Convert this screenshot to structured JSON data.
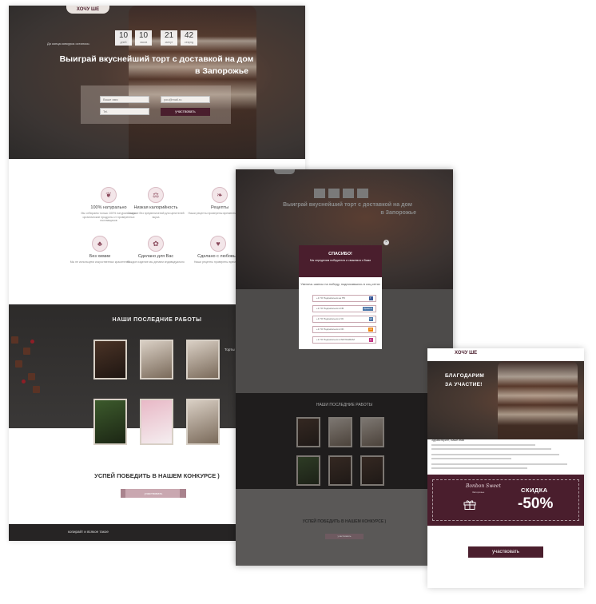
{
  "colors": {
    "brand_maroon": "#4a1e2d",
    "accent_pink": "#c9a7b0",
    "dark_bg": "#2d2b2a",
    "vk_blue": "#4a76a8",
    "fb_blue": "#3b5998",
    "ok_orange": "#ee8208",
    "ig_magenta": "#c13584"
  },
  "landing": {
    "logo": "ХОЧУ ШЕ",
    "timer_caption": "До конца конкурса осталось:",
    "timer": [
      {
        "value": "10",
        "unit": "дней"
      },
      {
        "value": "10",
        "unit": "часов"
      },
      {
        "value": "21",
        "unit": "минут"
      },
      {
        "value": "42",
        "unit": "секунд"
      }
    ],
    "hero_title_line1": "Выиграй вкуснейший торт с доставкой на дом",
    "hero_title_line2": "в Запорожье",
    "form": {
      "name_placeholder": "Ваше имя",
      "email_placeholder": "you@mail.ru",
      "phone_placeholder": "Tel.",
      "submit_label": "участвовать"
    },
    "features": [
      {
        "icon": "leaf-icon",
        "title": "100% натурально",
        "desc": "Мы отбираем только 100% натуральные и органические продукты от проверенных поставщиков"
      },
      {
        "icon": "scale-icon",
        "title": "Низкая калорийность",
        "desc": "Сладкое без преувеличений для ценителей вкуса"
      },
      {
        "icon": "book-icon",
        "title": "Рецепты",
        "desc": "Наши рецепты проверены временем и любовью"
      },
      {
        "icon": "cupcake-icon",
        "title": "Без химии",
        "desc": "Мы не используем искусственных красителей"
      },
      {
        "icon": "hands-icon",
        "title": "Сделано для Вас",
        "desc": "Каждое изделие мы делаем индивидуально"
      },
      {
        "icon": "heart-icon",
        "title": "Сделано с любовью",
        "desc": "Наши рецепты проверены временем"
      }
    ],
    "works_title": "НАШИ ПОСЛЕДНИЕ РАБОТЫ",
    "works_note": "Торты",
    "cta_title": "УСПЕЙ ПОБЕДИТЬ В НАШЕМ КОНКУРСЕ )",
    "cta_button": "участвовать",
    "footer_text": "копирайт и всякое такое"
  },
  "popup": {
    "title": "СПАСИБО!",
    "subtitle": "Мы определим победителя и свяжемся с Вами",
    "boost_text": "Увеличь шансы на победу, подписавшись в соц.сетях",
    "subscriptions": [
      {
        "label": "+1 ГО Подписаться на ТВ",
        "badge": "f",
        "color": "#3b5998"
      },
      {
        "label": "+1 ГО Подписаться в FB",
        "badge": "Нравится",
        "color": "#4a76a8"
      },
      {
        "label": "+1 ГО Подписаться в VK",
        "badge": "VK",
        "color": "#4a76a8"
      },
      {
        "label": "+1 ГО Подписаться в OK",
        "badge": "OK",
        "color": "#ee8208"
      },
      {
        "label": "+1 ГО Подписаться в INSTAGRAM",
        "badge": "ig",
        "color": "#c13584"
      }
    ],
    "close_label": "×"
  },
  "thanks": {
    "logo": "ХОЧУ ШЕ",
    "title_line1": "БЛАГОДАРИМ",
    "title_line2": "ЗА УЧАСТИЕ!",
    "greeting": "Здравствуйте, Ваше имя!",
    "promo_signature": "Bonbon Sweet",
    "promo_signature_sub": "Запорожье",
    "promo_label": "СКИДКА",
    "promo_value": "-50%",
    "button_label": "участвовать"
  }
}
